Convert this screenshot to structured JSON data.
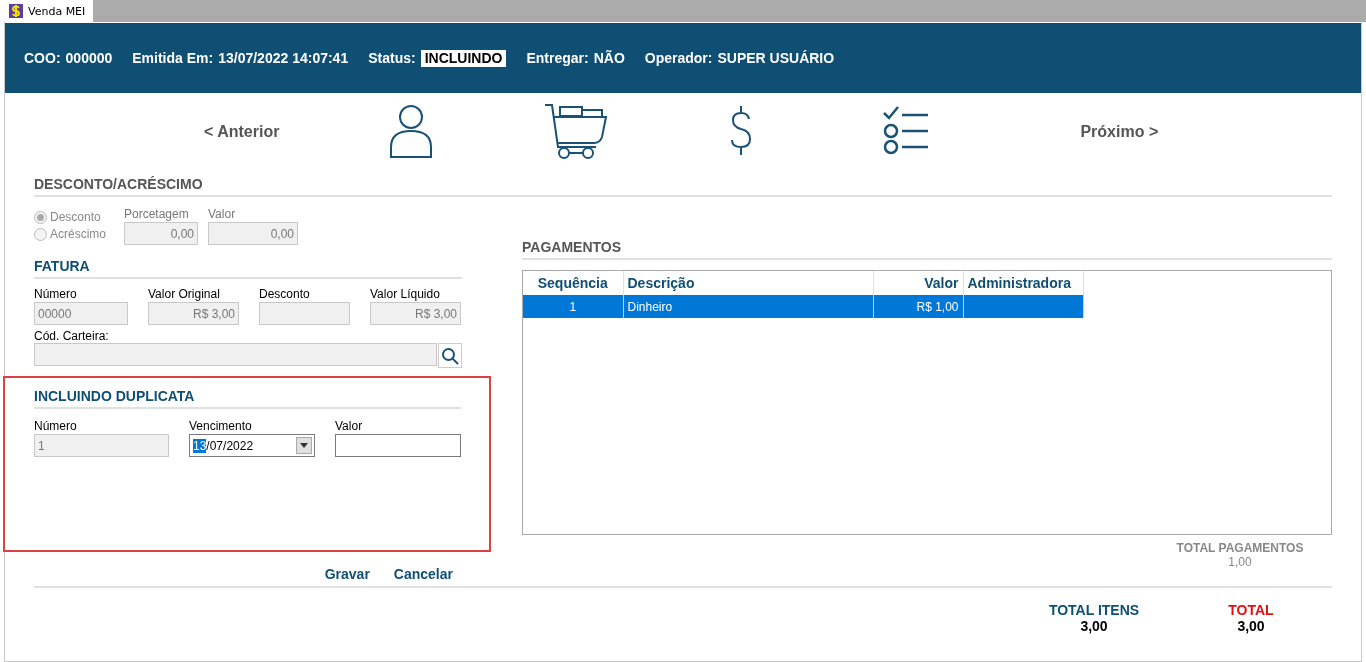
{
  "tab": {
    "title": "Venda MEI"
  },
  "header": [
    {
      "label": "COO:",
      "value": "000000",
      "kind": "plain"
    },
    {
      "label": "Emitida Em:",
      "value": "13/07/2022 14:07:41",
      "kind": "plain"
    },
    {
      "label": "Status:",
      "value": "INCLUINDO",
      "kind": "badge"
    },
    {
      "label": "Entregar:",
      "value": "NÃO",
      "kind": "plain"
    },
    {
      "label": "Operador:",
      "value": "SUPER USUÁRIO",
      "kind": "plain"
    }
  ],
  "nav": {
    "previous": "< Anterior",
    "next": "Próximo >",
    "steps": [
      {
        "kind": "customer"
      },
      {
        "kind": "cart"
      },
      {
        "kind": "payment"
      },
      {
        "kind": "checklist"
      }
    ]
  },
  "discount": {
    "title": "DESCONTO/ACRÉSCIMO",
    "disabled": true,
    "options": [
      {
        "label": "Desconto",
        "selected": true
      },
      {
        "label": "Acréscimo",
        "selected": false
      }
    ],
    "fields": [
      {
        "label": "Porcetagem",
        "value": "0,00"
      },
      {
        "label": "Valor",
        "value": "0,00"
      }
    ]
  },
  "fatura": {
    "title": "FATURA",
    "fields": [
      {
        "label": "Número",
        "value": "00000"
      },
      {
        "label": "Valor Original",
        "value": "R$ 3,00"
      },
      {
        "label": "Desconto"
      },
      {
        "label": "Valor Líquido",
        "value": "R$ 3,00"
      }
    ],
    "carteira": {
      "label": "Cód. Carteira:"
    }
  },
  "duplicata": {
    "title": "INCLUINDO DUPLICATA",
    "numero": {
      "label": "Número",
      "value": "1"
    },
    "vencimento": {
      "label": "Vencimento",
      "selected_part": "13",
      "rest": "/07/2022"
    },
    "valor": {
      "label": "Valor"
    }
  },
  "actions": [
    "Gravar",
    "Cancelar"
  ],
  "pagamentos": {
    "title": "PAGAMENTOS",
    "columns": [
      {
        "label": "Sequência"
      },
      {
        "label": "Descrição"
      },
      {
        "label": "Valor"
      },
      {
        "label": "Administradora"
      }
    ],
    "rows": [
      {
        "cells": [
          "1",
          "Dinheiro",
          "R$ 1,00",
          null
        ],
        "selected": true
      }
    ]
  },
  "totals": {
    "pagamentos": {
      "label": "TOTAL PAGAMENTOS",
      "value": "1,00"
    },
    "itens": {
      "label": "TOTAL ITENS",
      "value": "3,00"
    },
    "total": {
      "label": "TOTAL",
      "value": "3,00"
    }
  }
}
